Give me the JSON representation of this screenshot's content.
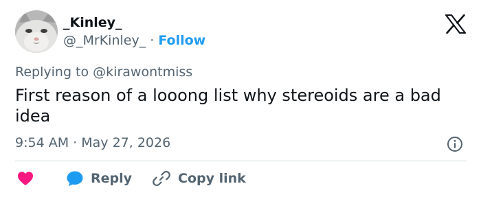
{
  "author": {
    "display_name": "_Kinley_",
    "handle": "@_MrKinley_",
    "separator": "·",
    "follow_label": "Follow",
    "avatar_icon": "cat-avatar"
  },
  "brand": {
    "logo_icon": "x-logo"
  },
  "tweet": {
    "replying_prefix": "Replying to",
    "replying_to": "@kirawontmiss",
    "text": "First reason of a looong list why stereoids are a bad idea",
    "time": "9:54 AM",
    "date_separator": "·",
    "date": "May 27, 2026"
  },
  "actions": {
    "like_icon": "heart-icon",
    "reply_label": "Reply",
    "copy_label": "Copy link"
  },
  "colors": {
    "accent": "#1d9bf0",
    "like": "#f91880",
    "text_primary": "#0f1419",
    "text_secondary": "#536471",
    "divider": "#cfd9de"
  }
}
